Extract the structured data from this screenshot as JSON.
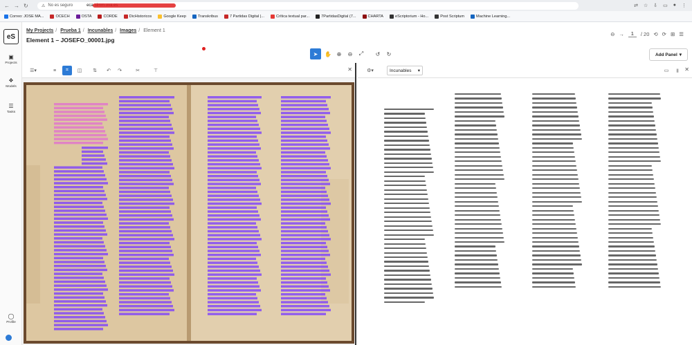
{
  "browser": {
    "security_label": "No es seguro",
    "url_fragment": "eca-simm.uva.es",
    "bookmarks": [
      {
        "label": "Correo: JOSE MA...",
        "color": "#1a73e8"
      },
      {
        "label": "OCECH",
        "color": "#c62828"
      },
      {
        "label": "OSTA",
        "color": "#6a1b9a"
      },
      {
        "label": "CORDE",
        "color": "#b71c1c"
      },
      {
        "label": "DicHistoricos",
        "color": "#c62828"
      },
      {
        "label": "Google Keep",
        "color": "#fbc02d"
      },
      {
        "label": "Transkribus",
        "color": "#1565c0"
      },
      {
        "label": "7 Partidas Digital |...",
        "color": "#c62828"
      },
      {
        "label": "Crítica textual par...",
        "color": "#e53935"
      },
      {
        "label": "7PartidasDigital (7...",
        "color": "#222222"
      },
      {
        "label": "CHARTA",
        "color": "#8d1010"
      },
      {
        "label": "eScriptorium - Ho...",
        "color": "#333333"
      },
      {
        "label": "Post Scriptum",
        "color": "#333333"
      },
      {
        "label": "Machine Learning...",
        "color": "#1565c0"
      }
    ]
  },
  "rail": {
    "logo": "eS",
    "projects": "Projects",
    "models": "Models",
    "tasks": "Tasks",
    "profile": "Profile"
  },
  "header": {
    "breadcrumb": [
      "My Projects",
      "Prueba 1",
      "Incunables",
      "Images"
    ],
    "current": "Element 1",
    "title": "Element 1 – JOSEFO_00001.jpg",
    "page_current": "1",
    "page_total": "/ 20"
  },
  "toolbar": {
    "add_panel": "Add Panel"
  },
  "right_panel": {
    "mode": "Incunables"
  },
  "colors": {
    "accent": "#2d7bd6",
    "line_purple": "#7a3cff",
    "line_pink": "#e070d0"
  }
}
